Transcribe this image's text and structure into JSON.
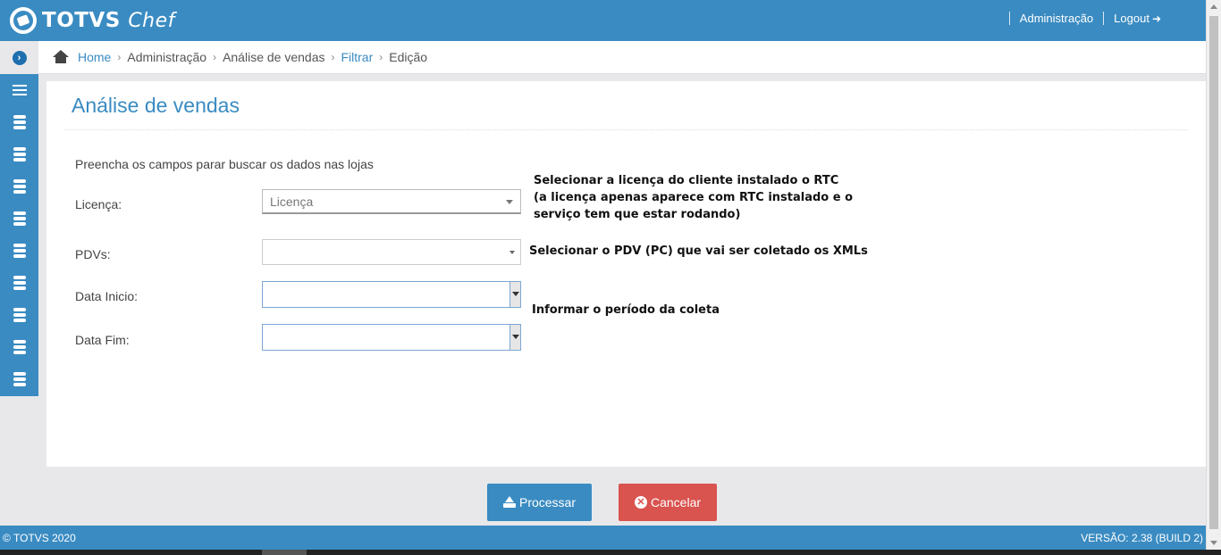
{
  "header": {
    "brand": "TOTVS",
    "brand_suffix": "Chef",
    "admin_link": "Administração",
    "logout_link": "Logout"
  },
  "breadcrumb": {
    "items": [
      {
        "label": "Home",
        "link": true
      },
      {
        "label": "Administração",
        "link": false
      },
      {
        "label": "Análise de vendas",
        "link": false
      },
      {
        "label": "Filtrar",
        "link": true
      },
      {
        "label": "Edição",
        "link": false
      }
    ]
  },
  "page": {
    "title": "Análise de vendas",
    "intro": "Preencha os campos parar buscar os dados nas lojas"
  },
  "form": {
    "licenca_label": "Licença:",
    "licenca_placeholder": "Licença",
    "pdvs_label": "PDVs:",
    "pdvs_value": "",
    "data_inicio_label": "Data Inicio:",
    "data_fim_label": "Data Fim:"
  },
  "notes": {
    "licenca": [
      "Selecionar a licença do cliente instalado o RTC",
      "(a licença apenas aparece com RTC instalado e o",
      "serviço tem que estar rodando)"
    ],
    "pdv": "Selecionar o PDV (PC) que vai ser coletado os XMLs",
    "periodo": "Informar o período da coleta"
  },
  "buttons": {
    "process": "Processar",
    "cancel": "Cancelar"
  },
  "footer": {
    "copyright": "© TOTVS 2020",
    "version": "VERSÃO: 2.38 (BUILD 2)"
  },
  "colors": {
    "primary": "#3a8bc2",
    "danger": "#d9534f"
  }
}
